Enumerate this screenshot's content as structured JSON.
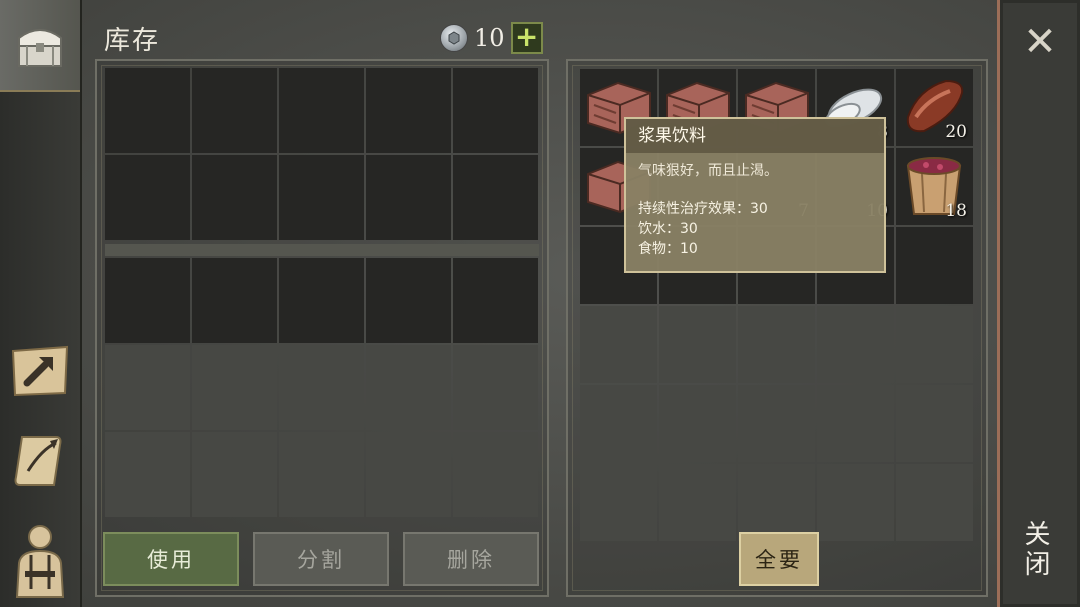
{
  "header": {
    "title": "库存",
    "currency_value": "10",
    "add_label": "+"
  },
  "sidebar": {
    "tabs": [
      {
        "name": "chest-tab",
        "icon": "chest-icon",
        "active": true
      },
      {
        "name": "crafting-tab",
        "icon": "hammer-icon",
        "active": false
      },
      {
        "name": "quest-tab",
        "icon": "scroll-icon",
        "active": false
      },
      {
        "name": "character-tab",
        "icon": "character-icon",
        "active": false
      }
    ]
  },
  "loot_items": [
    {
      "icon": "wooden-crate-icon",
      "qty": ""
    },
    {
      "icon": "wooden-crate-icon",
      "qty": ""
    },
    {
      "icon": "wooden-crate-icon",
      "qty": ""
    },
    {
      "icon": "bandage-roll-icon",
      "qty": "8"
    },
    {
      "icon": "raw-meat-icon",
      "qty": "20"
    },
    {
      "icon": "wooden-crate-icon",
      "qty": ""
    },
    {
      "icon": "",
      "qty": ""
    },
    {
      "icon": "",
      "qty": "7"
    },
    {
      "icon": "",
      "qty": "10"
    },
    {
      "icon": "berry-drink-bucket-icon",
      "qty": "18"
    }
  ],
  "tooltip": {
    "title": "浆果饮料",
    "description": "气味狠好，而且止渴。",
    "stats": [
      "持续性治疗效果：30",
      "饮水：30",
      "食物：10"
    ]
  },
  "buttons": {
    "use": "使用",
    "split": "分割",
    "delete": "删除",
    "take_all": "全要"
  },
  "close": {
    "label": "关闭",
    "icon": "close-icon"
  },
  "colors": {
    "accent_green": "#586a44",
    "gold_button": "#b8a77b",
    "close_border": "#9c6e58"
  }
}
